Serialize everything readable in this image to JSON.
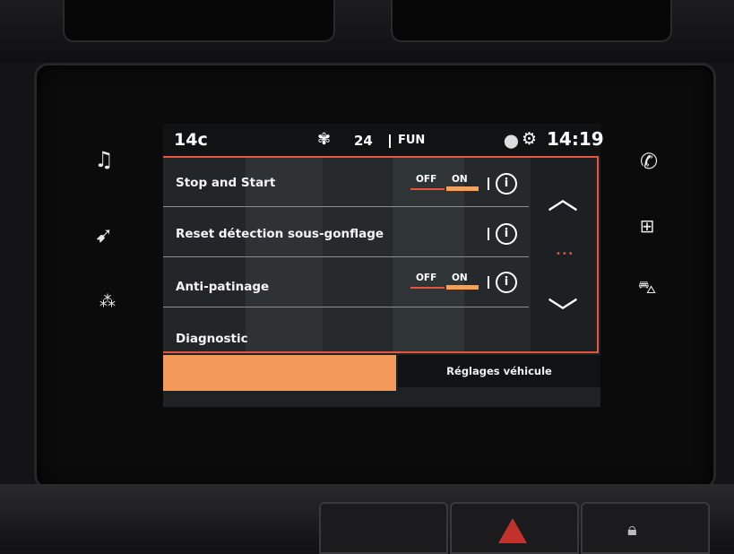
{
  "status": {
    "temperature": "14c",
    "fan_level": "24",
    "climate_mode": "FUN",
    "time": "14:19",
    "icons": [
      "fan-icon",
      "location-icon",
      "settings-gear-icon"
    ]
  },
  "side_menu": {
    "left": [
      "music-icon",
      "navigation-icon",
      "apps-icon"
    ],
    "right": [
      "phone-icon",
      "grid-icon",
      "car-icon"
    ]
  },
  "settings_list": {
    "rows": [
      {
        "label": "Stop and Start",
        "toggle_off": "OFF",
        "toggle_on": "ON",
        "state": "ON"
      },
      {
        "label": "Reset détection sous-gonflage"
      },
      {
        "label": "Anti-patinage",
        "toggle_off": "OFF",
        "toggle_on": "ON",
        "state": "ON"
      },
      {
        "label": "Diagnostic"
      }
    ],
    "info_glyph": "i",
    "scroll_dots": "•••"
  },
  "tabs": {
    "active": "",
    "inactive": "Réglages véhicule"
  },
  "colors": {
    "accent": "#e8553f",
    "toggle_on": "#f0a35e",
    "active_tab": "#f39a5a"
  }
}
